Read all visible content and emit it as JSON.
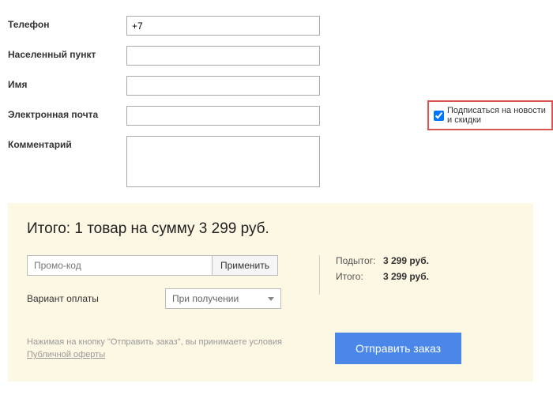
{
  "form": {
    "phone": {
      "label": "Телефон",
      "value": "+7"
    },
    "city": {
      "label": "Населенный пункт",
      "value": ""
    },
    "name": {
      "label": "Имя",
      "value": ""
    },
    "email": {
      "label": "Электронная почта",
      "value": ""
    },
    "comment": {
      "label": "Комментарий",
      "value": ""
    }
  },
  "subscribe": {
    "label": "Подписаться на новости и скидки",
    "checked": true
  },
  "summary": {
    "title": "Итого: 1 товар на сумму 3 299 руб.",
    "promo": {
      "placeholder": "Промо-код",
      "apply_label": "Применить"
    },
    "payment": {
      "label": "Вариант оплаты",
      "selected": "При получении"
    },
    "totals": {
      "subtotal_label": "Подытог:",
      "subtotal_value": "3 299 руб.",
      "total_label": "Итого:",
      "total_value": "3 299 руб."
    },
    "disclaimer_prefix": "Нажимая на кнопку \"Отправить заказ\", вы принимаете условия ",
    "disclaimer_link": "Публичной оферты",
    "submit_label": "Отправить заказ"
  }
}
